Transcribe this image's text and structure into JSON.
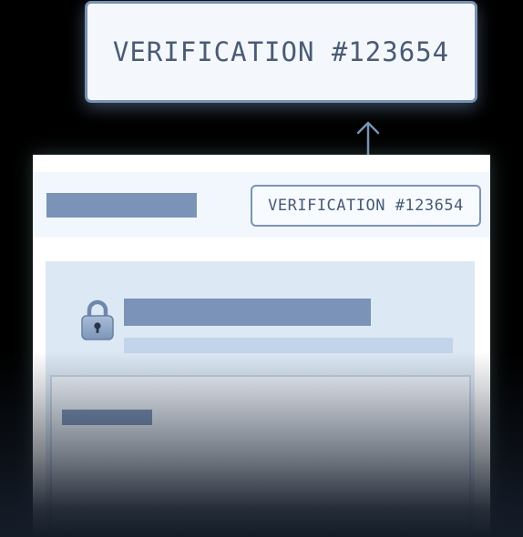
{
  "callout": {
    "text": "VERIFICATION #123654"
  },
  "card": {
    "header": {
      "badge_text": "VERIFICATION #123654"
    },
    "panel": {
      "icon": "lock-icon"
    }
  },
  "colors": {
    "accent": "#7b93b6",
    "badge_border": "#7b93b6",
    "panel_bg": "#dde8f5",
    "text": "#485a75"
  }
}
